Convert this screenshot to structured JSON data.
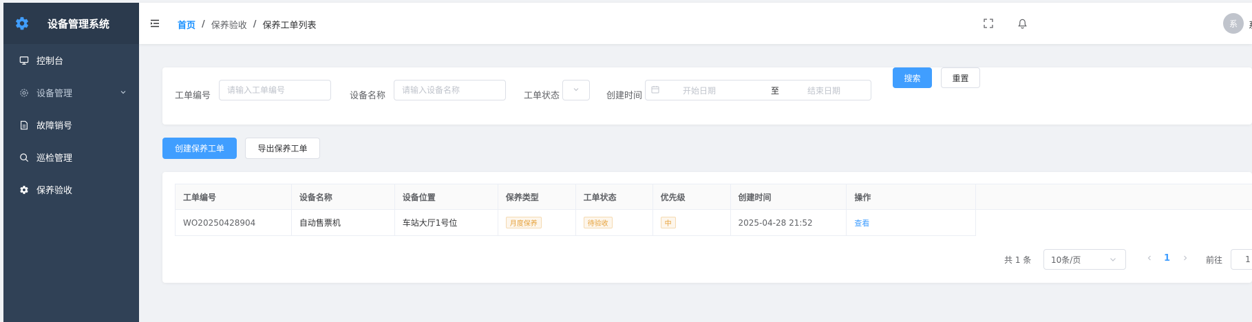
{
  "sidebar": {
    "title": "设备管理系统",
    "logo_icon": "gear-icon",
    "items": [
      {
        "label": "控制台",
        "icon": "monitor-icon"
      },
      {
        "label": "设备管理",
        "icon": "settings-icon",
        "has_children": true
      },
      {
        "label": "故障销号",
        "icon": "document-icon"
      },
      {
        "label": "巡检管理",
        "icon": "search-icon"
      },
      {
        "label": "保养验收",
        "icon": "gear-icon",
        "active": true
      }
    ],
    "bg_color": "#304156"
  },
  "header": {
    "breadcrumb": [
      "首页",
      "保养验收",
      "保养工单列表"
    ],
    "avatar_text": "系",
    "user_name": "系"
  },
  "search": {
    "order_no_label": "工单编号",
    "order_no_placeholder": "请输入工单编号",
    "device_name_label": "设备名称",
    "device_name_placeholder": "请输入设备名称",
    "status_label": "工单状态",
    "created_label": "创建时间",
    "start_placeholder": "开始日期",
    "range_sep": "至",
    "end_placeholder": "结束日期",
    "search_button": "搜索",
    "reset_button": "重置"
  },
  "actions": {
    "create_button": "创建保养工单",
    "export_button": "导出保养工单"
  },
  "table": {
    "columns": [
      "工单编号",
      "设备名称",
      "设备位置",
      "保养类型",
      "工单状态",
      "优先级",
      "创建时间",
      "操作"
    ],
    "rows": [
      {
        "order_no": "WO20250428904",
        "device_name": "自动售票机",
        "location": "车站大厅1号位",
        "type": "月度保养",
        "status": "待验收",
        "priority": "中",
        "created": "2025-04-28 21:52",
        "action": "查看"
      }
    ]
  },
  "pagination": {
    "total": "共 1 条",
    "page_size": "10条/页",
    "current_page": "1",
    "goto_label": "前往",
    "goto_value": "1"
  },
  "colors": {
    "primary": "#409eff",
    "warning": "#e6a23c"
  }
}
